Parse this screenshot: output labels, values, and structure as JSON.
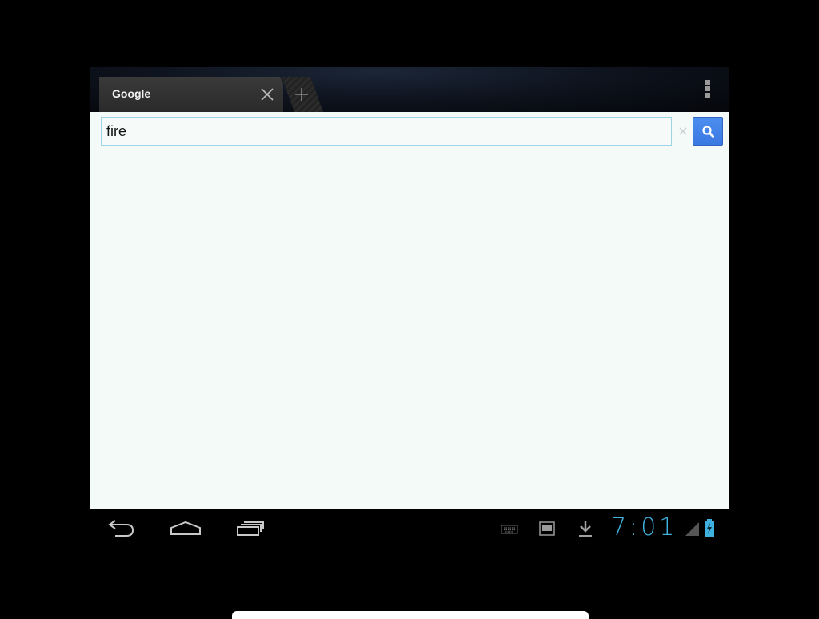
{
  "browser": {
    "tab": {
      "title": "Google",
      "close_icon": "close-icon"
    },
    "new_tab_icon": "plus-icon",
    "menu_icon": "overflow-menu-icon"
  },
  "urlbar": {
    "value": "fire",
    "clear_icon": "clear-icon",
    "search_icon": "search-icon",
    "accent_color": "#3a78e2"
  },
  "system_bar": {
    "nav": [
      "back-icon",
      "home-icon",
      "recent-apps-icon"
    ],
    "notifications": [
      "keyboard-icon",
      "screenshot-icon",
      "download-icon"
    ],
    "clock": "7:01",
    "clock_color": "#3fb1de",
    "signal_icon": "signal-icon",
    "battery_icon": "battery-charging-icon"
  }
}
